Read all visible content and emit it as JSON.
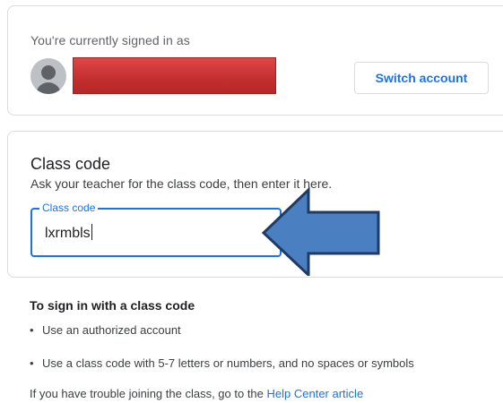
{
  "account": {
    "signed_in_label": "You're currently signed in as",
    "switch_button": "Switch account"
  },
  "class_code": {
    "title": "Class code",
    "description": "Ask your teacher for the class code, then enter it here.",
    "field_label": "Class code",
    "field_value": "lxrmbls"
  },
  "help": {
    "title": "To sign in with a class code",
    "bullets": [
      "Use an authorized account",
      "Use a class code with 5-7 letters or numbers, and no spaces or symbols"
    ],
    "trouble_text": "If you have trouble joining the class, go to the ",
    "link_text": "Help Center article"
  },
  "icons": {
    "avatar": "account-circle-icon",
    "annotation": "left-arrow-icon"
  },
  "colors": {
    "accent": "#1a73e8",
    "redaction": "#c53030",
    "arrow_fill": "#4a7fc1",
    "arrow_stroke": "#1f3a66"
  }
}
